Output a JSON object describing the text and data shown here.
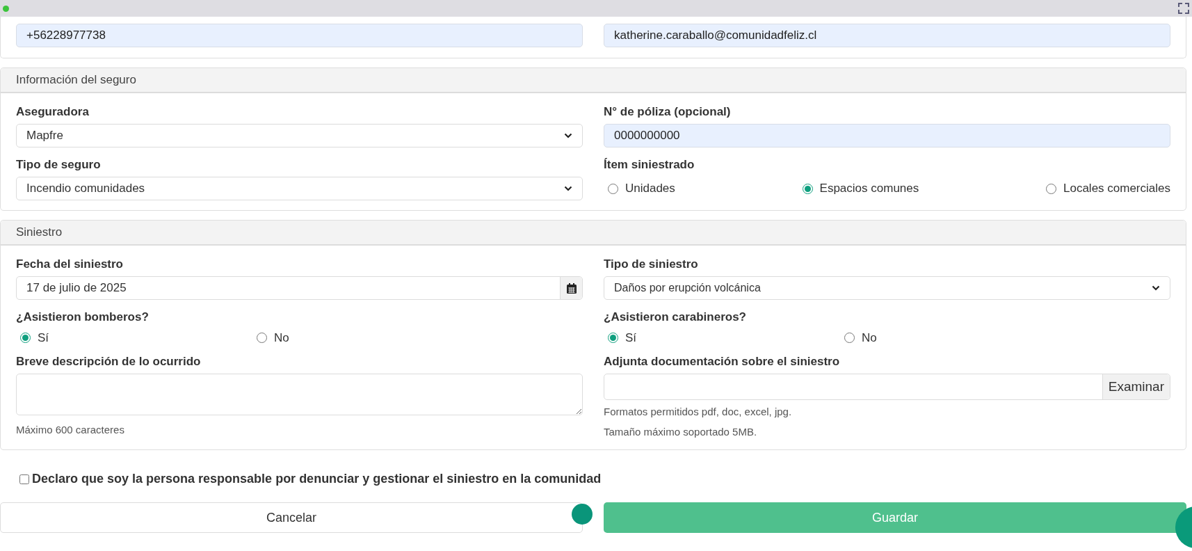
{
  "contact": {
    "phone": "+56228977738",
    "email": "katherine.caraballo@comunidadfeliz.cl"
  },
  "insurance": {
    "title": "Información del seguro",
    "insurer": {
      "label": "Aseguradora",
      "value": "Mapfre"
    },
    "policy": {
      "label": "N° de póliza (opcional)",
      "value": "0000000000"
    },
    "insurance_type": {
      "label": "Tipo de seguro",
      "value": "Incendio comunidades"
    },
    "item": {
      "label": "Ítem siniestrado",
      "options": [
        {
          "label": "Unidades",
          "selected": false
        },
        {
          "label": "Espacios comunes",
          "selected": true
        },
        {
          "label": "Locales comerciales",
          "selected": false
        }
      ]
    }
  },
  "claim": {
    "title": "Siniestro",
    "date": {
      "label": "Fecha del siniestro",
      "value": "17 de julio de 2025"
    },
    "claim_type": {
      "label": "Tipo de siniestro",
      "value": "Daños por erupción volcánica"
    },
    "firefighters": {
      "label": "¿Asistieron bomberos?",
      "options": [
        {
          "label": "Sí",
          "selected": true
        },
        {
          "label": "No",
          "selected": false
        }
      ]
    },
    "police": {
      "label": "¿Asistieron carabineros?",
      "options": [
        {
          "label": "Sí",
          "selected": true
        },
        {
          "label": "No",
          "selected": false
        }
      ]
    },
    "description": {
      "label": "Breve descripción de lo ocurrido",
      "hint": "Máximo 600 caracteres"
    },
    "attachment": {
      "label": "Adjunta documentación sobre el siniestro",
      "button": "Examinar",
      "hints": [
        "Formatos permitidos pdf, doc, excel, jpg.",
        "Tamaño máximo soportado 5MB."
      ]
    }
  },
  "declaration": {
    "label": "Declaro que soy la persona responsable por denunciar y gestionar el siniestro en la comunidad",
    "checked": false
  },
  "buttons": {
    "cancel": "Cancelar",
    "save": "Guardar"
  }
}
